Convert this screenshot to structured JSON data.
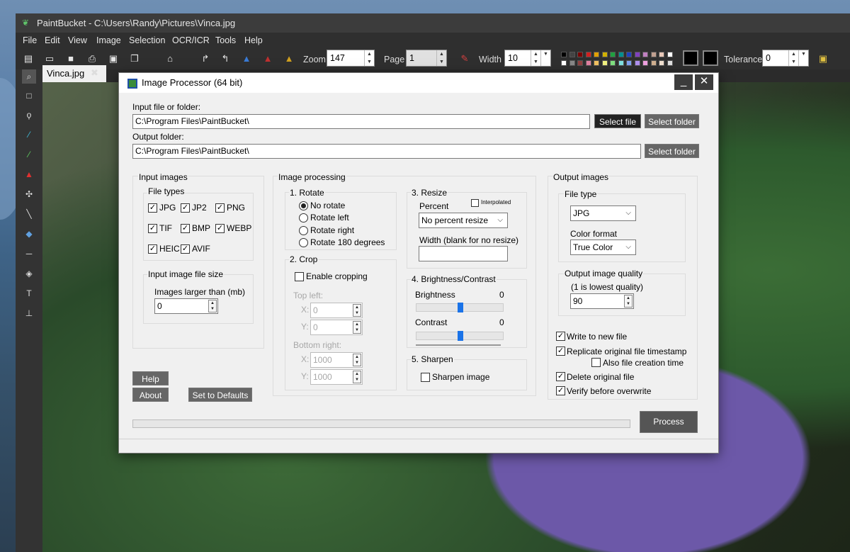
{
  "window": {
    "title": "PaintBucket - C:\\Users\\Randy\\Pictures\\Vinca.jpg"
  },
  "menu": [
    "File",
    "Edit",
    "View",
    "Image",
    "Selection",
    "OCR/ICR",
    "Tools",
    "Help"
  ],
  "toolbar": {
    "zoom_label": "Zoom",
    "zoom_value": "147",
    "page_label": "Page",
    "page_value": "1",
    "width_label": "Width",
    "width_value": "10",
    "tolerance_label": "Tolerance",
    "tolerance_value": "0",
    "palette_row1": [
      "#000000",
      "#444444",
      "#7a0000",
      "#d02020",
      "#e0a000",
      "#d0b000",
      "#20a040",
      "#009090",
      "#2040c0",
      "#8040c0",
      "#c080c0",
      "#c0a090",
      "#e8c8b8",
      "#ffffff"
    ],
    "palette_row2": [
      "#ffffff",
      "#888888",
      "#904040",
      "#e080a0",
      "#f0c060",
      "#f0f080",
      "#80e080",
      "#80e0e0",
      "#80a0f0",
      "#b090f0",
      "#f0a0e0",
      "#d0b090",
      "#f0e0d0",
      "#e0e0e0"
    ]
  },
  "document_tab": "Vinca.jpg",
  "dialog": {
    "title": "Image Processor (64 bit)",
    "input_label": "Input file or folder:",
    "input_value": "C:\\Program Files\\PaintBucket\\",
    "select_file": "Select file",
    "select_folder": "Select folder",
    "output_label": "Output folder:",
    "output_value": "C:\\Program Files\\PaintBucket\\",
    "select_folder_out": "Select folder",
    "input_images": {
      "title": "Input images",
      "file_types_title": "File types",
      "types": [
        "JPG",
        "JP2",
        "PNG",
        "TIF",
        "BMP",
        "WEBP",
        "HEIC",
        "AVIF"
      ],
      "size_title": "Input image file size",
      "larger_than_label": "Images larger than (mb)",
      "larger_than_value": "0"
    },
    "processing": {
      "title": "Image processing",
      "rotate_title": "1. Rotate",
      "rotate_options": [
        "No rotate",
        "Rotate left",
        "Rotate right",
        "Rotate 180 degrees"
      ],
      "rotate_selected": "No rotate",
      "crop_title": "2. Crop",
      "enable_cropping": "Enable cropping",
      "top_left": "Top left:",
      "x_label": "X:",
      "y_label": "Y:",
      "tl_x": "0",
      "tl_y": "0",
      "bottom_right": "Bottom right:",
      "br_x": "1000",
      "br_y": "1000",
      "resize_title": "3. Resize",
      "interpolated": "Interpolated",
      "percent_label": "Percent",
      "percent_value": "No percent resize",
      "width_label": "Width (blank for no resize)",
      "width_value": "",
      "bc_title": "4. Brightness/Contrast",
      "brightness_label": "Brightness",
      "brightness_value": "0",
      "contrast_label": "Contrast",
      "contrast_value": "0",
      "sharpen_title": "5. Sharpen",
      "sharpen_image": "Sharpen image"
    },
    "output": {
      "title": "Output images",
      "file_type_title": "File type",
      "file_type_value": "JPG",
      "color_format_label": "Color format",
      "color_format_value": "True Color",
      "quality_title": "Output image quality",
      "quality_sub": "(1 is lowest quality)",
      "quality_value": "90",
      "write_new": "Write to new file",
      "replicate_ts": "Replicate original file timestamp",
      "also_creation": "Also file creation time",
      "delete_original": "Delete original file",
      "verify_overwrite": "Verify before overwrite"
    },
    "help_button": "Help",
    "about_button": "About",
    "defaults_button": "Set to Defaults",
    "process_button": "Process"
  }
}
